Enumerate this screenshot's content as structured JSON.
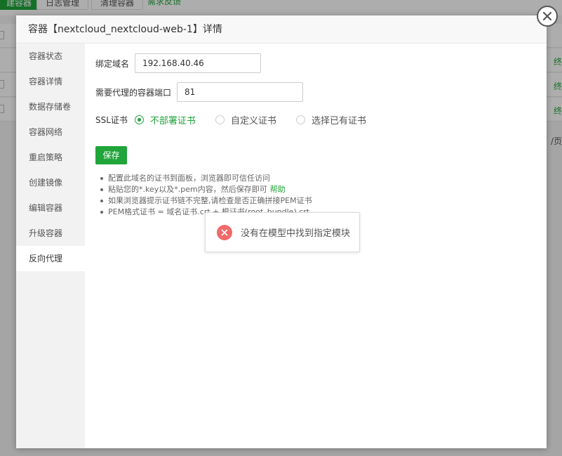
{
  "background": {
    "buttons": [
      "建容器",
      "日志管理",
      "清理容器"
    ],
    "feedback_link": "需求反馈",
    "row_action": "终",
    "pager_unit": "/页"
  },
  "dialog": {
    "title": "容器【nextcloud_nextcloud-web-1】详情",
    "sidebar": [
      "容器状态",
      "容器详情",
      "数据存储卷",
      "容器网络",
      "重启策略",
      "创建镜像",
      "编辑容器",
      "升级容器",
      "反向代理"
    ],
    "active_item": "反向代理",
    "form": {
      "domain_label": "绑定域名",
      "domain_value": "192.168.40.46",
      "port_label": "需要代理的容器端口",
      "port_value": "81",
      "ssl_label": "SSL证书",
      "ssl_options": [
        "不部署证书",
        "自定义证书",
        "选择已有证书"
      ],
      "ssl_selected": "不部署证书",
      "save_label": "保存"
    },
    "tips": [
      "配置此域名的证书到面板，浏览器即可信任访问",
      "粘贴您的*.key以及*.pem内容，然后保存即可",
      "如果浏览器提示证书链不完整,请检查是否正确拼接PEM证书",
      "PEM格式证书 = 域名证书.crt + 根证书(root_bundle).crt"
    ],
    "help_link": "帮助"
  },
  "toast": {
    "message": "没有在模型中找到指定模块"
  },
  "colors": {
    "accent": "#20a53a",
    "error": "#f06a6a"
  }
}
